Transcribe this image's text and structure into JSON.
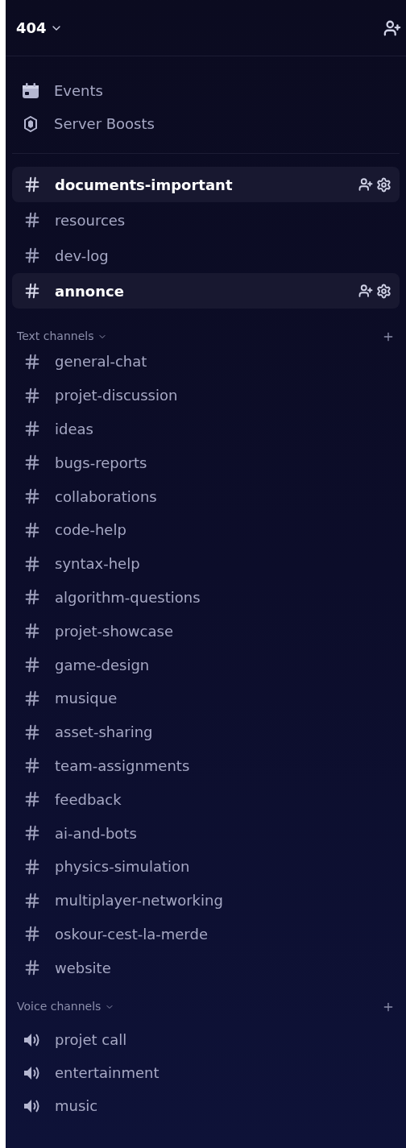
{
  "server": {
    "name": "404"
  },
  "shortcuts": [
    {
      "kind": "events",
      "label": "Events"
    },
    {
      "kind": "boosts",
      "label": "Server Boosts"
    }
  ],
  "pinned_channels": [
    {
      "name": "documents-important",
      "active": true
    },
    {
      "name": "resources",
      "active": false
    },
    {
      "name": "dev-log",
      "active": false
    },
    {
      "name": "annonce",
      "active": true
    }
  ],
  "categories": [
    {
      "kind": "text",
      "title": "Text channels",
      "channels": [
        {
          "name": "general-chat"
        },
        {
          "name": "projet-discussion"
        },
        {
          "name": "ideas"
        },
        {
          "name": "bugs-reports"
        },
        {
          "name": "collaborations"
        },
        {
          "name": "code-help"
        },
        {
          "name": "syntax-help"
        },
        {
          "name": "algorithm-questions"
        },
        {
          "name": "projet-showcase"
        },
        {
          "name": "game-design"
        },
        {
          "name": "musique"
        },
        {
          "name": "asset-sharing"
        },
        {
          "name": "team-assignments"
        },
        {
          "name": "feedback"
        },
        {
          "name": "ai-and-bots"
        },
        {
          "name": "physics-simulation"
        },
        {
          "name": "multiplayer-networking"
        },
        {
          "name": "oskour-cest-la-merde"
        },
        {
          "name": "website"
        }
      ]
    },
    {
      "kind": "voice",
      "title": "Voice channels",
      "channels": [
        {
          "name": "projet call"
        },
        {
          "name": "entertainment"
        },
        {
          "name": "music"
        }
      ]
    }
  ]
}
